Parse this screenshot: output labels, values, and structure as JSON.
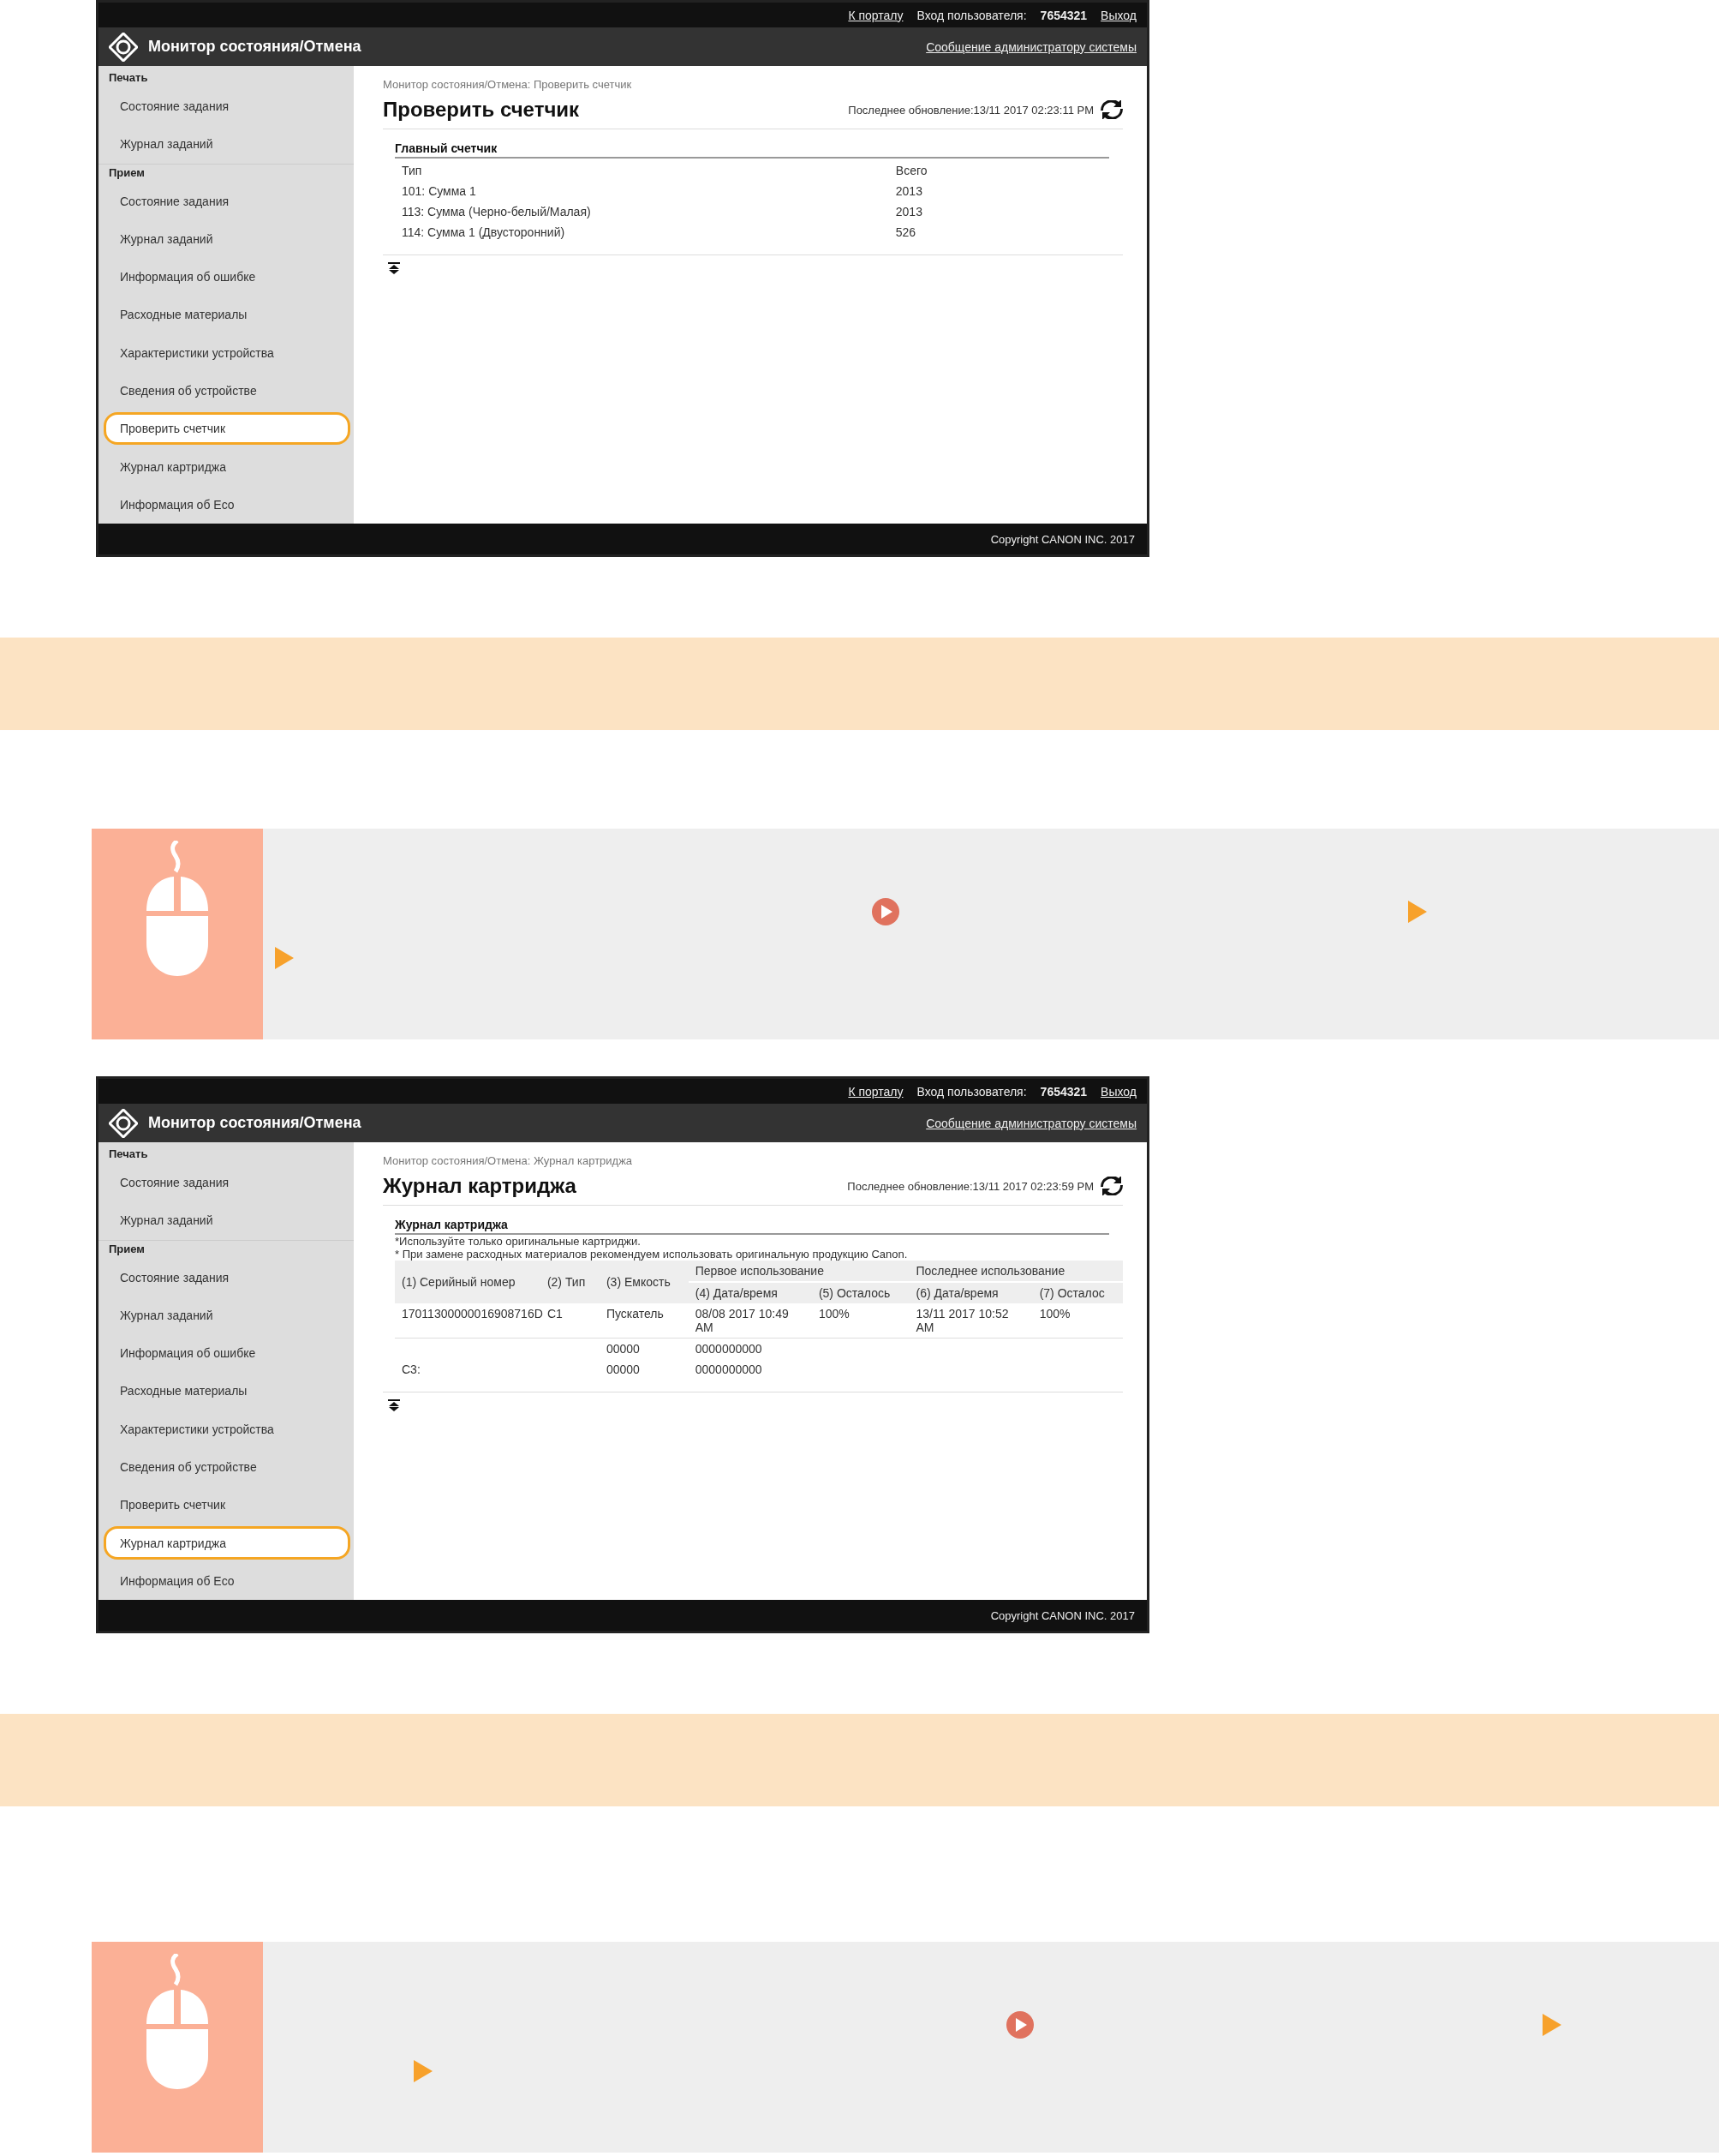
{
  "sections": [
    {
      "kind": "screenshot",
      "top_links": [
        "К порталу",
        "Вход пользователя:",
        "7654321",
        "Выход"
      ],
      "app_title": "Монитор состояния/Отмена",
      "admin_link": "Сообщение администратору системы",
      "sidebar": [
        {
          "label": "Печать",
          "items": [
            {
              "label": "Состояние задания",
              "selected": false
            },
            {
              "label": "Журнал заданий",
              "selected": false
            }
          ]
        },
        {
          "label": "Прием",
          "items": [
            {
              "label": "Состояние задания",
              "selected": false
            },
            {
              "label": "Журнал заданий",
              "selected": false
            },
            {
              "label": "Информация об ошибке",
              "selected": false
            },
            {
              "label": "Расходные материалы",
              "selected": false
            },
            {
              "label": "Характеристики устройства",
              "selected": false
            },
            {
              "label": "Сведения об устройстве",
              "selected": false
            },
            {
              "label": "Проверить счетчик",
              "selected": true
            },
            {
              "label": "Журнал картриджа",
              "selected": false
            },
            {
              "label": "Информация об Eco",
              "selected": false
            }
          ]
        }
      ],
      "breadcrumb": "Монитор состояния/Отмена: Проверить счетчик",
      "page_title": "Проверить счетчик",
      "last_updated": "Последнее обновление:13/11 2017 02:23:11 PM",
      "content": {
        "kind": "counter",
        "section_title": "Главный счетчик",
        "columns": [
          "Тип",
          "Всего"
        ],
        "rows": [
          [
            "101: Сумма 1",
            "2013"
          ],
          [
            "113: Сумма (Черно-белый/Малая)",
            "2013"
          ],
          [
            "114: Сумма 1 (Двусторонний)",
            "526"
          ]
        ]
      },
      "footer": "Copyright CANON INC. 2017"
    },
    {
      "kind": "band"
    },
    {
      "kind": "mouse-note"
    },
    {
      "kind": "screenshot",
      "top_links": [
        "К порталу",
        "Вход пользователя:",
        "7654321",
        "Выход"
      ],
      "app_title": "Монитор состояния/Отмена",
      "admin_link": "Сообщение администратору системы",
      "sidebar": [
        {
          "label": "Печать",
          "items": [
            {
              "label": "Состояние задания",
              "selected": false
            },
            {
              "label": "Журнал заданий",
              "selected": false
            }
          ]
        },
        {
          "label": "Прием",
          "items": [
            {
              "label": "Состояние задания",
              "selected": false
            },
            {
              "label": "Журнал заданий",
              "selected": false
            },
            {
              "label": "Информация об ошибке",
              "selected": false
            },
            {
              "label": "Расходные материалы",
              "selected": false
            },
            {
              "label": "Характеристики устройства",
              "selected": false
            },
            {
              "label": "Сведения об устройстве",
              "selected": false
            },
            {
              "label": "Проверить счетчик",
              "selected": false
            },
            {
              "label": "Журнал картриджа",
              "selected": true
            },
            {
              "label": "Информация об Eco",
              "selected": false
            }
          ]
        }
      ],
      "breadcrumb": "Монитор состояния/Отмена: Журнал картриджа",
      "page_title": "Журнал картриджа",
      "last_updated": "Последнее обновление:13/11 2017 02:23:59 PM",
      "content": {
        "kind": "cartridge",
        "section_title": "Журнал картриджа",
        "notes": [
          "*Используйте только оригинальные картриджи.",
          "* При замене расходных материалов рекомендуем использовать оригинальную продукцию Canon."
        ],
        "column_groups": [
          "Первое использование",
          "Последнее использование"
        ],
        "columns": [
          "(1) Серийный номер",
          "(2) Тип",
          "(3) Емкость",
          "(4) Дата/время",
          "(5) Осталось",
          "(6) Дата/время",
          "(7) Осталос"
        ],
        "rows": [
          [
            "17011300000016908716D",
            "C1",
            "Пускатель",
            "08/08 2017 10:49 AM",
            "100%",
            "13/11 2017 10:52 AM",
            "100%"
          ],
          [
            "",
            "",
            "00000",
            "0000000000",
            "",
            "",
            ""
          ],
          [
            "C3:",
            "",
            "00000",
            "0000000000",
            "",
            "",
            ""
          ]
        ]
      },
      "footer": "Copyright CANON INC. 2017"
    },
    {
      "kind": "band"
    },
    {
      "kind": "mouse-note"
    }
  ]
}
